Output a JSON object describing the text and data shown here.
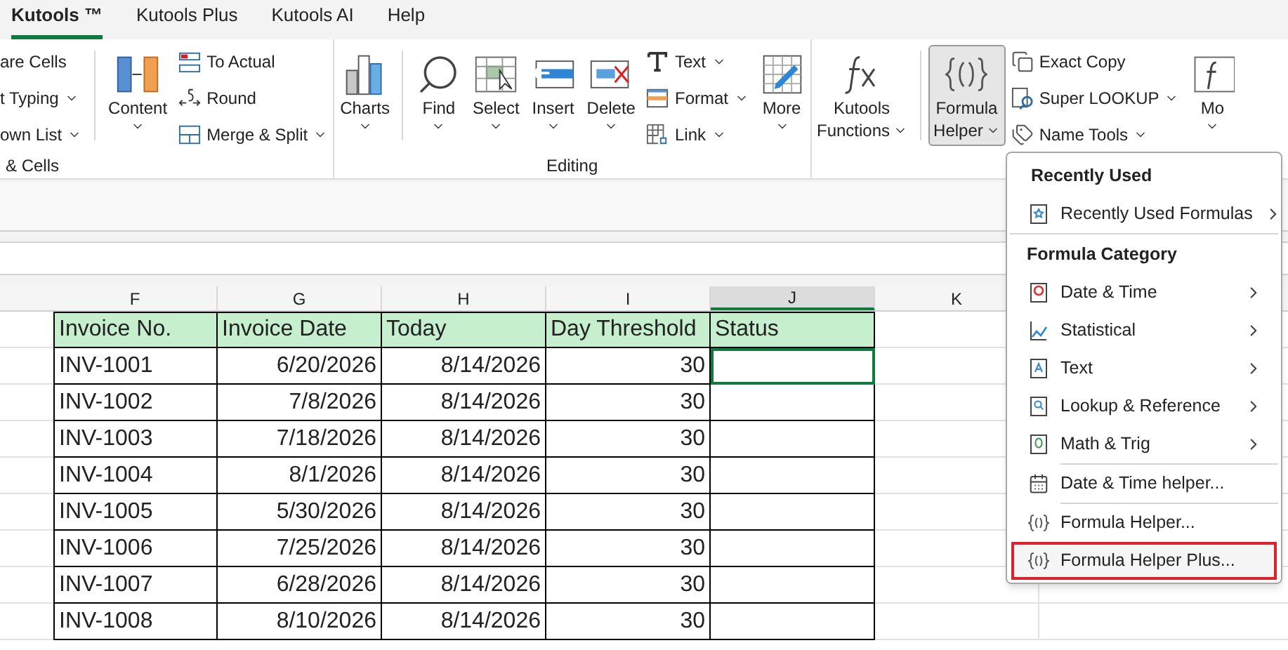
{
  "menu_tabs": [
    {
      "label": "Kutools ™",
      "selected": true
    },
    {
      "label": "Kutools Plus",
      "selected": false
    },
    {
      "label": "Kutools AI",
      "selected": false
    },
    {
      "label": "Help",
      "selected": false
    }
  ],
  "ribbon_groups": [
    {
      "label": "& Cells",
      "columns": [
        {
          "kind": "stack",
          "items": [
            {
              "label": "are Cells",
              "dropdown": false
            },
            {
              "label": "t Typing",
              "dropdown": true
            },
            {
              "label": "own List",
              "dropdown": true
            }
          ]
        },
        {
          "kind": "separator"
        },
        {
          "kind": "large",
          "lines": [
            "Content"
          ],
          "dropdown": true,
          "pressed": false
        },
        {
          "kind": "stack",
          "items": [
            {
              "label": "To Actual",
              "dropdown": false
            },
            {
              "label": "Round",
              "dropdown": false
            },
            {
              "label": "Merge & Split",
              "dropdown": true
            }
          ]
        }
      ]
    },
    {
      "label": "Editing",
      "columns": [
        {
          "kind": "large",
          "lines": [
            "Charts"
          ],
          "dropdown": true,
          "pressed": false
        },
        {
          "kind": "separator"
        },
        {
          "kind": "large",
          "lines": [
            "Find"
          ],
          "dropdown": true,
          "pressed": false
        },
        {
          "kind": "large",
          "lines": [
            "Select"
          ],
          "dropdown": true,
          "pressed": false
        },
        {
          "kind": "large",
          "lines": [
            "Insert"
          ],
          "dropdown": true,
          "pressed": false
        },
        {
          "kind": "large",
          "lines": [
            "Delete"
          ],
          "dropdown": true,
          "pressed": false
        },
        {
          "kind": "stack",
          "items": [
            {
              "label": "Text",
              "dropdown": true
            },
            {
              "label": "Format",
              "dropdown": true
            },
            {
              "label": "Link",
              "dropdown": true
            }
          ]
        },
        {
          "kind": "large",
          "lines": [
            "More"
          ],
          "dropdown": true,
          "pressed": false
        }
      ]
    },
    {
      "columns": [
        {
          "kind": "large",
          "lines": [
            "Kutools",
            "Functions"
          ],
          "dropdown": true,
          "pressed": false
        },
        {
          "kind": "separator"
        },
        {
          "kind": "large",
          "lines": [
            "Formula",
            "Helper"
          ],
          "dropdown": true,
          "pressed": true
        },
        {
          "kind": "stack",
          "items": [
            {
              "label": "Exact Copy",
              "dropdown": false
            },
            {
              "label": "Super LOOKUP",
              "dropdown": true
            },
            {
              "label": "Name Tools",
              "dropdown": true
            }
          ]
        },
        {
          "kind": "large",
          "lines": [
            "Mo"
          ],
          "dropdown": true,
          "pressed": false
        }
      ]
    }
  ],
  "sheet": {
    "column_headers": [
      {
        "label": "F",
        "selected": false
      },
      {
        "label": "G",
        "selected": false
      },
      {
        "label": "H",
        "selected": false
      },
      {
        "label": "I",
        "selected": false
      },
      {
        "label": "J",
        "selected": true
      },
      {
        "label": "K",
        "selected": false
      }
    ],
    "columns": [
      {
        "header": "Invoice No."
      },
      {
        "header": "Invoice Date"
      },
      {
        "header": "Today"
      },
      {
        "header": "Day Threshold"
      },
      {
        "header": "Status"
      }
    ],
    "rows": [
      {
        "cells": [
          "INV-1001",
          "6/20/2026",
          "8/14/2026",
          "30",
          ""
        ],
        "active": true
      },
      {
        "cells": [
          "INV-1002",
          "7/8/2026",
          "8/14/2026",
          "30",
          ""
        ],
        "active": false
      },
      {
        "cells": [
          "INV-1003",
          "7/18/2026",
          "8/14/2026",
          "30",
          ""
        ],
        "active": false
      },
      {
        "cells": [
          "INV-1004",
          "8/1/2026",
          "8/14/2026",
          "30",
          ""
        ],
        "active": false
      },
      {
        "cells": [
          "INV-1005",
          "5/30/2026",
          "8/14/2026",
          "30",
          ""
        ],
        "active": false
      },
      {
        "cells": [
          "INV-1006",
          "7/25/2026",
          "8/14/2026",
          "30",
          ""
        ],
        "active": false
      },
      {
        "cells": [
          "INV-1007",
          "6/28/2026",
          "8/14/2026",
          "30",
          ""
        ],
        "active": false
      },
      {
        "cells": [
          "INV-1008",
          "8/10/2026",
          "8/14/2026",
          "30",
          ""
        ],
        "active": false
      }
    ]
  },
  "dropdown_menu": {
    "items": [
      {
        "kind": "heading",
        "label": "Recently Used",
        "divider_above": false
      },
      {
        "kind": "item",
        "label": "Recently Used Formulas",
        "submenu": true,
        "divider_above": false,
        "highlighted": false
      },
      {
        "kind": "heading",
        "label": "Formula Category",
        "divider_above": true
      },
      {
        "kind": "item",
        "label": "Date & Time",
        "submenu": true,
        "divider_above": false,
        "highlighted": false
      },
      {
        "kind": "item",
        "label": "Statistical",
        "submenu": true,
        "divider_above": false,
        "highlighted": false
      },
      {
        "kind": "item",
        "label": "Text",
        "submenu": true,
        "divider_above": false,
        "highlighted": false
      },
      {
        "kind": "item",
        "label": "Lookup & Reference",
        "submenu": true,
        "divider_above": false,
        "highlighted": false
      },
      {
        "kind": "item",
        "label": "Math & Trig",
        "submenu": true,
        "divider_above": false,
        "highlighted": false
      },
      {
        "kind": "item",
        "label": "Date & Time helper...",
        "submenu": false,
        "divider_above": true,
        "highlighted": false
      },
      {
        "kind": "item",
        "label": "Formula Helper...",
        "submenu": false,
        "divider_above": true,
        "highlighted": false
      },
      {
        "kind": "item",
        "label": "Formula Helper Plus...",
        "submenu": false,
        "divider_above": false,
        "highlighted": true
      }
    ]
  }
}
